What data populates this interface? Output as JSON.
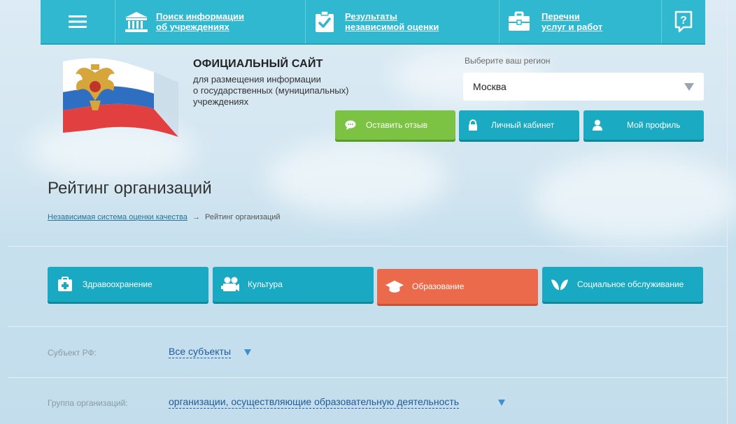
{
  "nav": {
    "items": [
      {
        "line1": "Поиск информации",
        "line2": "об учреждениях",
        "icon": "building-icon"
      },
      {
        "line1": "Результаты",
        "line2": "независимой оценки",
        "icon": "check-clipboard-icon"
      },
      {
        "line1": "Перечни",
        "line2": "услуг и работ",
        "icon": "briefcase-icon"
      }
    ],
    "help_icon_text": "?"
  },
  "header": {
    "title": "ОФИЦИАЛЬНЫЙ САЙТ",
    "subtitle_line1": "для размещения информации",
    "subtitle_line2": "о государственных (муниципальных)",
    "subtitle_line3": "учреждениях"
  },
  "region": {
    "label": "Выберите ваш регион",
    "selected": "Москва"
  },
  "buttons": {
    "feedback": "Оставить отзыв",
    "cabinet": "Личный кабинет",
    "profile": "Мой профиль"
  },
  "page": {
    "heading": "Рейтинг организаций",
    "breadcrumb_link": "Независимая система оценки качества",
    "breadcrumb_sep": "→",
    "breadcrumb_current": "Рейтинг организаций"
  },
  "categories": [
    {
      "label": "Здравоохранение",
      "icon": "medical-kit-icon",
      "active": false
    },
    {
      "label": "Культура",
      "icon": "film-camera-icon",
      "active": false
    },
    {
      "label": "Образование",
      "icon": "graduation-cap-icon",
      "active": true
    },
    {
      "label": "Социальное обслуживание",
      "icon": "helping-hands-icon",
      "active": false
    }
  ],
  "filters": {
    "subject_label": "Субъект РФ:",
    "subject_value": "Все субъекты",
    "group_label": "Группа организаций:",
    "group_value": "организации, осуществляющие образовательную деятельность"
  },
  "colors": {
    "nav": "#2fb8cf",
    "accent_blue": "#19a9c2",
    "accent_green": "#7cc243",
    "accent_orange": "#ec6a4c",
    "link": "#1f5b9a"
  }
}
